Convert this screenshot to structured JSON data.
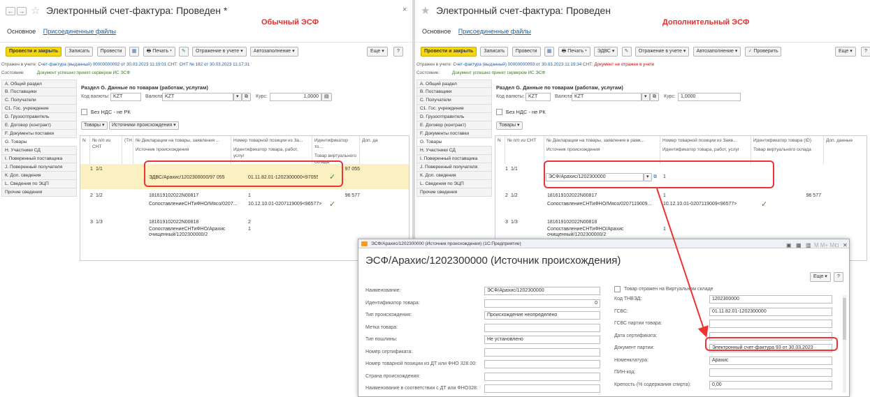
{
  "left": {
    "title": "Электронный счет-фактура: Проведен *",
    "annotation": "Обычный ЭСФ",
    "tabs": [
      "Основное",
      "Присоединенные файлы"
    ],
    "toolbar": {
      "post_close": "Провести и закрыть",
      "save": "Записать",
      "post": "Провести",
      "print": "Печать",
      "reflect": "Отражение в учете",
      "autofill": "Автозаполнение",
      "more": "Еще",
      "help": "?"
    },
    "reflected_label": "Отражен в учете:",
    "reflected_link": "Счет-фактура (выданный) 00000000092 от 30.03.2023 11:19:01",
    "cht_label": "СНТ:",
    "cht_link": "СНТ № 182 от 30.03.2023 11:17:31",
    "state_label": "Состояние:",
    "state_value": "Документ успешно принят сервером ИС ЭСФ",
    "section_title": "Раздел G. Данные по товарам (работам, услугам)",
    "currency_code_label": "Код валюты:",
    "currency_code": "KZT",
    "currency_label": "Валюта:",
    "currency": "KZT",
    "rate_label": "Курс:",
    "rate": "1,0000",
    "no_vat": "Без НДС - не РК",
    "goods_btn": "Товары",
    "sources_btn": "Источники происхождения",
    "headers": {
      "n": "N",
      "pn": "№ п/п из СНТ",
      "th": "(ТН",
      "decl": "№ Декларации на товары, заявления ...",
      "src": "Источник происхождения",
      "posnum": "Номер товарной позиции из За...",
      "id": "Идентификатор товара, работ, услуг",
      "ident": "Идентификатор то...",
      "virt": "Товар виртуального склада",
      "dop": "Доп. да"
    },
    "rows": [
      {
        "n": "1",
        "pn": "1/1",
        "decl": "",
        "src": "ЭДВС/Арахис/1202300000/97 055",
        "pos": "",
        "id": "01.11.82.01-1202300000<97055>",
        "val": "97 055"
      },
      {
        "n": "2",
        "pn": "1/2",
        "decl": "181619102022N00817",
        "src": "СопоставлениеСНТиФНО/Мясо/0207...",
        "pos": "1",
        "id": "10.12.10.01-0207119009<96577>",
        "val": "96 577"
      },
      {
        "n": "3",
        "pn": "1/3",
        "decl": "181619102022N00818",
        "src": "СопоставлениеСНТиФНО/Арахис очищенный/1202300000/2",
        "pos": "2",
        "id": "1",
        "val": ""
      }
    ]
  },
  "right": {
    "title": "Электронный счет-фактура: Проведен",
    "annotation": "Дополнительный ЭСФ",
    "tabs": [
      "Основное",
      "Присоединенные файлы"
    ],
    "toolbar": {
      "post_close": "Провести и закрыть",
      "save": "Записать",
      "post": "Провести",
      "print": "Печать",
      "esf": "ЭДВС",
      "reflect": "Отражение в учете",
      "autofill": "Автозаполнение",
      "check": "Проверить",
      "more": "Еще",
      "help": "?"
    },
    "reflected_label": "Отражен в учете:",
    "reflected_link": "Счет-фактура (выданный) 00000000093 от 30.03.2023 11:19:34",
    "cht_label": "СНТ:",
    "cht_text": "Документ не отражен в учете",
    "state_label": "Состояние:",
    "state_value": "Документ успешно принят сервером ИС ЭСФ",
    "section_title": "Раздел G. Данные по товарам (работам, услугам)",
    "currency_code_label": "Код валюты:",
    "currency_code": "KZT",
    "currency_label": "Валюта:",
    "currency": "KZT",
    "rate_label": "Курс:",
    "rate": "1,0000",
    "no_vat": "Без НДС - не РК",
    "goods_btn": "Товары",
    "headers": {
      "n": "N",
      "pn": "№ п/п из СНТ",
      "decl": "№ Декларации на товары, заявления в рамк...",
      "src": "Источник происхождения",
      "posnum": "Номер товарной позиции из Заяв...",
      "id": "Идентификатор товара, работ, услуг",
      "ident": "Идентификатор товара (ID)",
      "virt": "Товар виртуального склада",
      "dop": "Доп. данные"
    },
    "rows": [
      {
        "n": "1",
        "pn": "1/1",
        "decl": "",
        "src": "ЭСФ/Арахис/1202300000",
        "pos": "1",
        "id": "",
        "val": ""
      },
      {
        "n": "2",
        "pn": "1/2",
        "decl": "181619102022N00817",
        "src": "СопоставлениеСНТиФНО/Мясо/0207119009...",
        "pos": "1",
        "id": "10.12.10.01-0207119009<96577>",
        "val": "96 577"
      },
      {
        "n": "3",
        "pn": "1/3",
        "decl": "181619102022N00818",
        "src": "СопоставлениеСНТиФНО/Арахис очищенный/1202300000/2",
        "pos": "1",
        "id": "",
        "val": ""
      }
    ]
  },
  "sidenav": [
    "А. Общий раздел",
    "В. Поставщики",
    "С. Получатели",
    "С1. Гос. учреждение",
    "D. Грузоотправитель",
    "Е. Договор (контракт)",
    "F. Документы поставки",
    "G. Товары",
    "Н. Участники СД",
    "I. Поверенный поставщика",
    "J. Поверенный получателя",
    "К. Доп. сведения",
    "L. Сведения по ЭЦП",
    "Прочие сведения"
  ],
  "dialog": {
    "bar_title": "ЭСФ/Арахис/1202300000 (Источник происхождения) (1С:Предприятие)",
    "title": "ЭСФ/Арахис/1202300000 (Источник происхождения)",
    "more": "Еще",
    "help": "?",
    "fields_left": [
      {
        "label": "Наименование:",
        "value": "ЭСФ/Арахис/1202300000"
      },
      {
        "label": "Идентификатор товара:",
        "value": "0"
      },
      {
        "label": "Тип происхождения:",
        "value": "Происхождение неопределено"
      },
      {
        "label": "Метка товара:",
        "value": ""
      },
      {
        "label": "Тип пошлины:",
        "value": "Не установлено"
      },
      {
        "label": "Номер сертификата:",
        "value": ""
      },
      {
        "label": "Номер товарной позиции из ДТ или ФНО 328.00:",
        "value": ""
      },
      {
        "label": "Страна происхождения:",
        "value": ""
      },
      {
        "label": "Наименование в соответствии с ДТ или ФНО328:",
        "value": ""
      }
    ],
    "virtual_check": "Товар отражен на Виртуальном складе",
    "fields_right": [
      {
        "label": "Код ТНВЭД:",
        "value": "1202300000"
      },
      {
        "label": "ГСВС:",
        "value": "01.11.82.01-1202300000"
      },
      {
        "label": "ГСВС партии товара:",
        "value": ""
      },
      {
        "label": "Дата сертификата:",
        "value": ""
      },
      {
        "label": "Документ партии:",
        "value": "Электронный счет-фактура 93 от 30.03.2023"
      },
      {
        "label": "Номенклатура:",
        "value": "Арахис"
      },
      {
        "label": "ПИН-код:",
        "value": ""
      },
      {
        "label": "Крепость (% содержания спирта):",
        "value": "0,00"
      }
    ]
  }
}
